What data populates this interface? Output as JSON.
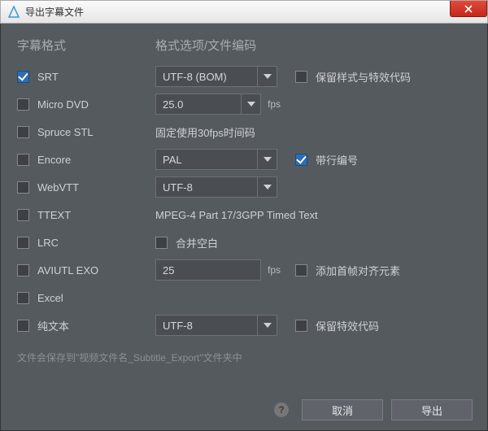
{
  "window": {
    "title": "导出字幕文件"
  },
  "headers": {
    "left": "字幕格式",
    "mid": "格式选项/文件编码"
  },
  "formats": {
    "srt": {
      "label": "SRT",
      "checked": true
    },
    "microdvd": {
      "label": "Micro DVD",
      "checked": false
    },
    "sprucestl": {
      "label": "Spruce STL",
      "checked": false
    },
    "encore": {
      "label": "Encore",
      "checked": false
    },
    "webvtt": {
      "label": "WebVTT",
      "checked": false
    },
    "ttext": {
      "label": "TTEXT",
      "checked": false
    },
    "lrc": {
      "label": "LRC",
      "checked": false
    },
    "aviutl": {
      "label": "AVIUTL EXO",
      "checked": false
    },
    "excel": {
      "label": "Excel",
      "checked": false
    },
    "plaintext": {
      "label": "纯文本",
      "checked": false
    }
  },
  "options": {
    "srt_encoding": "UTF-8 (BOM)",
    "microdvd_fps": "25.0",
    "microdvd_unit": "fps",
    "sprucestl_note": "固定使用30fps时间码",
    "encore_region": "PAL",
    "webvtt_encoding": "UTF-8",
    "ttext_note": "MPEG-4 Part 17/3GPP Timed Text",
    "aviutl_fps": "25",
    "aviutl_unit": "fps",
    "plaintext_encoding": "UTF-8"
  },
  "right": {
    "srt_keep_style": {
      "label": "保留样式与特效代码",
      "checked": false
    },
    "encore_line_number": {
      "label": "带行编号",
      "checked": true
    },
    "lrc_merge_blank": {
      "label": "合并空白",
      "checked": false
    },
    "aviutl_add_align": {
      "label": "添加首帧对齐元素",
      "checked": false
    },
    "plaintext_keep_effect": {
      "label": "保留特效代码",
      "checked": false
    }
  },
  "footer": {
    "note": "文件会保存到\"视频文件名_Subtitle_Export\"文件夹中"
  },
  "buttons": {
    "cancel": "取消",
    "export": "导出"
  }
}
